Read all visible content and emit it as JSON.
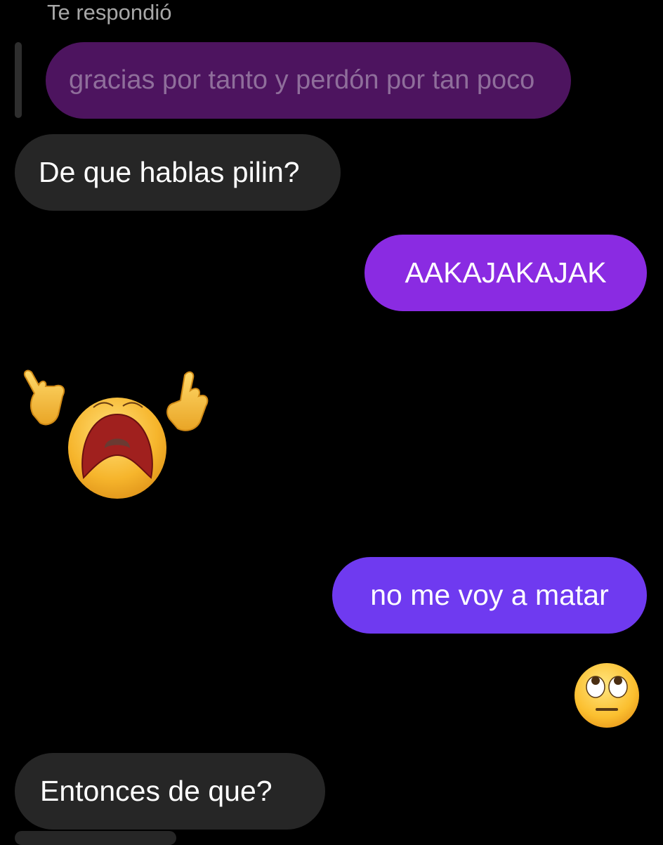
{
  "reply_context": {
    "label": "Te respondió",
    "quoted_message": "gracias por tanto y perdón por tan poco"
  },
  "messages": [
    {
      "direction": "received",
      "text": "De que hablas pilin?"
    },
    {
      "direction": "sent",
      "text": "AAKAJAKAJAK"
    },
    {
      "direction": "received",
      "sticker": "screaming-face-sticker"
    },
    {
      "direction": "sent",
      "text": "no me voy a matar"
    },
    {
      "direction": "sent",
      "emoji": "face-with-rolling-eyes"
    },
    {
      "direction": "received",
      "text": "Entonces de que?"
    }
  ],
  "colors": {
    "background": "#000000",
    "received_bubble": "#262626",
    "sent_bubble_top": "#8a2be2",
    "sent_bubble_bottom": "#6f3af0",
    "quoted_bubble": "#4d145f"
  }
}
